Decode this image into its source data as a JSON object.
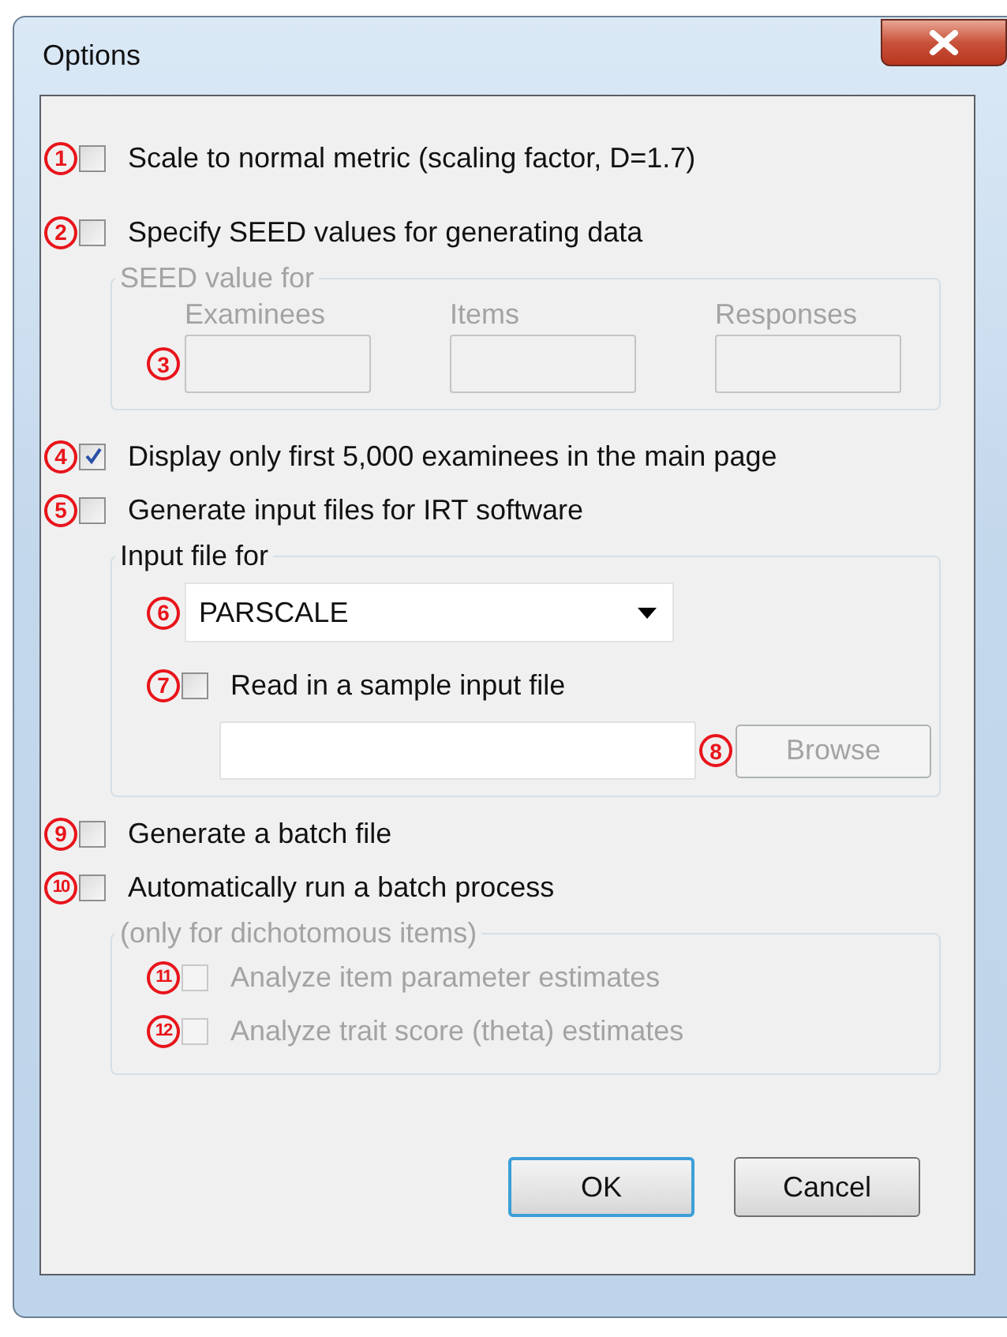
{
  "window": {
    "title": "Options"
  },
  "options": [
    {
      "kind": "checkbox",
      "marker": "1",
      "label": "Scale to normal metric (scaling factor, D=1.7)",
      "checked": false,
      "disabled": false
    },
    {
      "kind": "checkbox",
      "marker": "2",
      "label": "Specify SEED values for generating data",
      "checked": false,
      "disabled": false
    },
    {
      "kind": "group",
      "title": "SEED value for",
      "disabled": true,
      "items": [
        {
          "kind": "fields",
          "fields": [
            {
              "label": "Examinees",
              "marker": "3"
            },
            {
              "label": "Items"
            },
            {
              "label": "Responses"
            }
          ]
        }
      ]
    },
    {
      "kind": "checkbox",
      "marker": "4",
      "label": "Display only first 5,000 examinees in the main page",
      "checked": true,
      "disabled": false
    },
    {
      "kind": "checkbox",
      "marker": "5",
      "label": "Generate input files for IRT software",
      "checked": false,
      "disabled": false
    },
    {
      "kind": "group",
      "title": "Input file for",
      "disabled": false,
      "items": [
        {
          "kind": "dropdown",
          "marker": "6",
          "value": "PARSCALE"
        },
        {
          "kind": "checkbox",
          "marker": "7",
          "label": "Read in a sample input file",
          "checked": false,
          "disabled": false
        },
        {
          "kind": "file",
          "marker": "8",
          "button": "Browse",
          "button_disabled": true
        }
      ]
    },
    {
      "kind": "checkbox",
      "marker": "9",
      "label": "Generate a batch file",
      "checked": false,
      "disabled": false
    },
    {
      "kind": "checkbox",
      "marker": "10",
      "label": "Automatically run a batch process",
      "checked": false,
      "disabled": false
    },
    {
      "kind": "group",
      "title": "(only for dichotomous items)",
      "disabled": true,
      "items": [
        {
          "kind": "checkbox",
          "marker": "11",
          "label": "Analyze item parameter estimates",
          "checked": false,
          "disabled": true
        },
        {
          "kind": "checkbox",
          "marker": "12",
          "label": "Analyze trait score (theta) estimates",
          "checked": false,
          "disabled": true
        }
      ]
    }
  ],
  "buttons": [
    {
      "label": "OK",
      "default": true
    },
    {
      "label": "Cancel",
      "default": false
    }
  ]
}
